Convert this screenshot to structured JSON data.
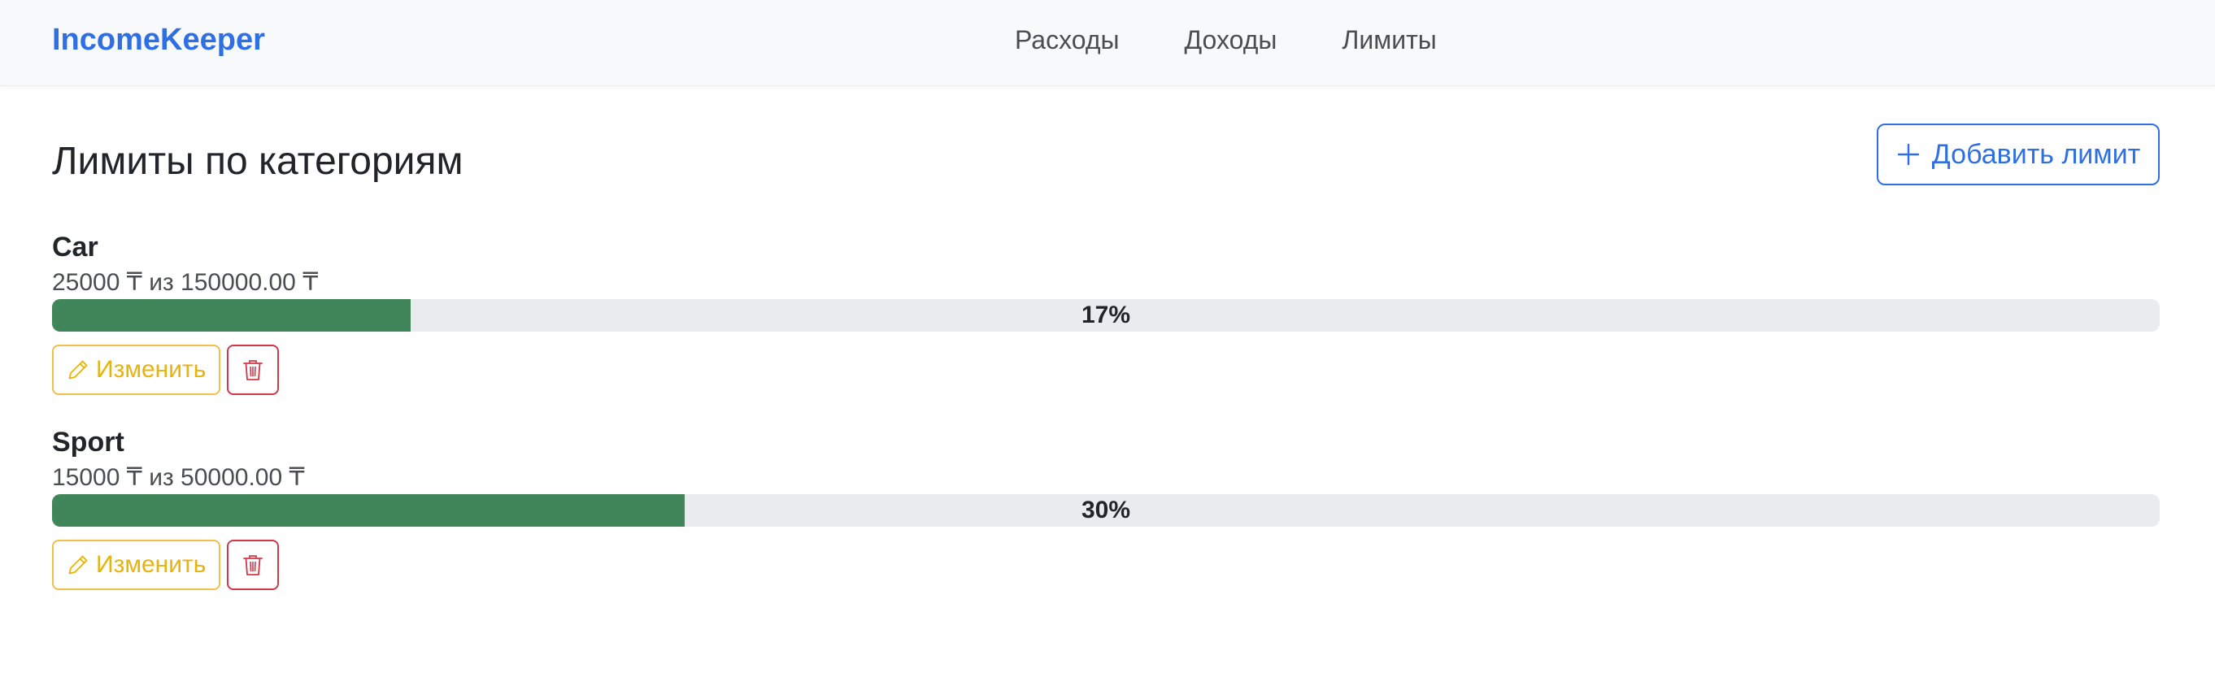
{
  "app": {
    "brand": "IncomeKeeper",
    "colors": {
      "brand": "#2f6fe4",
      "progress": "#41855a",
      "edit": "#e8b30e",
      "delete": "#d1394b"
    }
  },
  "nav": {
    "items": [
      {
        "label": "Расходы"
      },
      {
        "label": "Доходы"
      },
      {
        "label": "Лимиты"
      }
    ]
  },
  "page": {
    "title": "Лимиты по категориям",
    "add_button": {
      "label": "Добавить лимит",
      "icon": "plus-icon"
    }
  },
  "limits": [
    {
      "name": "Car",
      "spent": "25000 ₸",
      "separator": " из ",
      "limit": "150000.00 ₸",
      "percent_label": "17%",
      "progress_fraction": 0.17,
      "edit_label": "Изменить",
      "edit_icon": "pencil-icon",
      "delete_icon": "trash-icon"
    },
    {
      "name": "Sport",
      "spent": "15000 ₸",
      "separator": " из ",
      "limit": "50000.00 ₸",
      "percent_label": "30%",
      "progress_fraction": 0.3,
      "edit_label": "Изменить",
      "edit_icon": "pencil-icon",
      "delete_icon": "trash-icon"
    }
  ]
}
